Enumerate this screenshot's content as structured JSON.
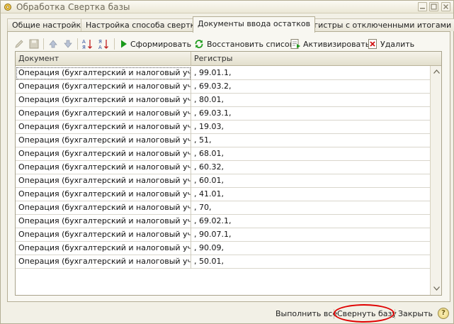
{
  "window": {
    "title": "Обработка  Свертка базы",
    "icon": "gear-icon",
    "title_buttons": [
      "minimize-icon",
      "maximize-icon",
      "close-icon"
    ]
  },
  "tabs": [
    {
      "label": "Общие настройки",
      "active": false
    },
    {
      "label": "Настройка способа свертки",
      "active": false
    },
    {
      "label": "Документы ввода остатков",
      "active": true
    },
    {
      "label": "Регистры с отключенными итогами",
      "active": false
    }
  ],
  "toolbar": {
    "form_label": "Сформировать",
    "restore_label": "Восстановить список",
    "activate_label": "Активизировать",
    "delete_label": "Удалить",
    "icons": [
      "edit-icon",
      "save-icon",
      "arrow-up-icon",
      "arrow-down-icon",
      "sort-asc-icon",
      "sort-desc-icon",
      "play-icon",
      "refresh-icon",
      "activate-icon",
      "delete-icon"
    ]
  },
  "table": {
    "columns": [
      "Документ",
      "Регистры"
    ],
    "rows": [
      {
        "doc": "Операция (бухгалтерский и налоговый учет) ...",
        "reg": ", 99.01.1,"
      },
      {
        "doc": "Операция (бухгалтерский и налоговый учет) ...",
        "reg": ", 69.03.2,"
      },
      {
        "doc": "Операция (бухгалтерский и налоговый учет) ...",
        "reg": ", 80.01,"
      },
      {
        "doc": "Операция (бухгалтерский и налоговый учет) ...",
        "reg": ", 69.03.1,"
      },
      {
        "doc": "Операция (бухгалтерский и налоговый учет) ...",
        "reg": ", 19.03,"
      },
      {
        "doc": "Операция (бухгалтерский и налоговый учет) ...",
        "reg": ", 51,"
      },
      {
        "doc": "Операция (бухгалтерский и налоговый учет) ...",
        "reg": ", 68.01,"
      },
      {
        "doc": "Операция (бухгалтерский и налоговый учет) ...",
        "reg": ", 60.32,"
      },
      {
        "doc": "Операция (бухгалтерский и налоговый учет) ...",
        "reg": ", 60.01,"
      },
      {
        "doc": "Операция (бухгалтерский и налоговый учет) ...",
        "reg": ", 41.01,"
      },
      {
        "doc": "Операция (бухгалтерский и налоговый учет) ...",
        "reg": ", 70,"
      },
      {
        "doc": "Операция (бухгалтерский и налоговый учет) ...",
        "reg": ", 69.02.1,"
      },
      {
        "doc": "Операция (бухгалтерский и налоговый учет) ...",
        "reg": ", 90.07.1,"
      },
      {
        "doc": "Операция (бухгалтерский и налоговый учет) ...",
        "reg": ", 90.09,"
      },
      {
        "doc": "Операция (бухгалтерский и налоговый учет) ...",
        "reg": ", 50.01,"
      }
    ]
  },
  "footer": {
    "execute_all": "Выполнить все",
    "collapse_db": "Свернуть базу",
    "close": "Закрыть",
    "help": "?"
  },
  "colors": {
    "window_bg": "#f2f0e6",
    "highlight_circle": "#e00000",
    "play_green": "#1a9a1a",
    "delete_red": "#d01010"
  }
}
